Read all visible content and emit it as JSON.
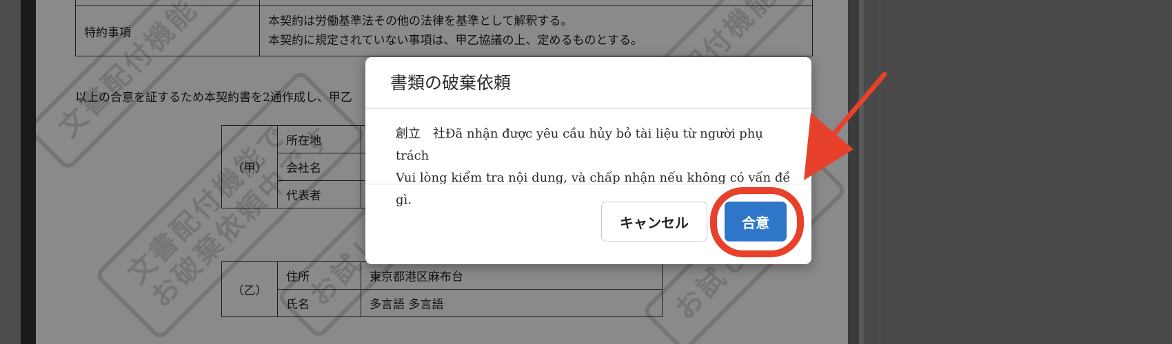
{
  "document": {
    "clause_label": "特約事項",
    "clause_lines": [
      "本契約は労働基準法その他の法律を基準として解釈する。",
      "本契約に規定されていない事項は、甲乙協議の上、定めるものとする。"
    ],
    "agreement_line": "以上の合意を証するため本契約書を2通作成し、甲乙",
    "party_a": {
      "label": "（甲）",
      "rows": [
        {
          "field": "所在地",
          "value": ""
        },
        {
          "field": "会社名",
          "value": ""
        },
        {
          "field": "代表者",
          "value": ""
        }
      ]
    },
    "party_b": {
      "label": "（乙）",
      "rows": [
        {
          "field": "住所",
          "value": "東京都港区麻布台"
        },
        {
          "field": "氏名",
          "value": "多言語 多言語"
        }
      ]
    },
    "watermarks": [
      "文書配付機能で",
      "お試し中です",
      "文書配付機能で",
      "お破棄依頼中です"
    ]
  },
  "dialog": {
    "title": "書類の破棄依頼",
    "body_line1": "創立　社Đã nhận được yêu cầu hủy bỏ tài liệu từ người phụ trách",
    "body_line2": "Vui lòng kiểm tra nội dung, và chấp nhận nếu không có vấn đề gì.",
    "cancel_label": "キャンセル",
    "agree_label": "合意"
  },
  "colors": {
    "agree_button": "#2f76c8",
    "annotation_red": "#e8412b"
  }
}
